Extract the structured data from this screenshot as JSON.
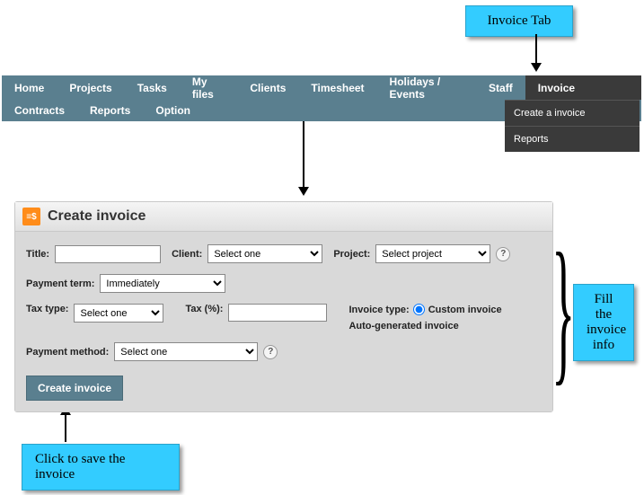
{
  "callouts": {
    "top": "Invoice Tab",
    "right": "Fill the invoice info",
    "bottom": "Click to save the invoice"
  },
  "nav": {
    "row1": [
      "Home",
      "Projects",
      "Tasks",
      "My files",
      "Clients",
      "Timesheet",
      "Holidays / Events",
      "Staff",
      "Invoice"
    ],
    "row2": [
      "Contracts",
      "Reports",
      "Option"
    ]
  },
  "dropdown": {
    "items": [
      "Create a invoice",
      "Reports"
    ]
  },
  "panel": {
    "title": "Create invoice"
  },
  "form": {
    "title_label": "Title:",
    "title_value": "",
    "client_label": "Client:",
    "client_selected": "Select one",
    "project_label": "Project:",
    "project_selected": "Select project",
    "payment_term_label": "Payment term:",
    "payment_term_selected": "Immediately",
    "tax_type_label": "Tax type:",
    "tax_type_selected": "Select one",
    "tax_pct_label": "Tax (%):",
    "tax_pct_value": "",
    "invoice_type_label": "Invoice type:",
    "invoice_type_options": {
      "custom": "Custom invoice",
      "auto": "Auto-generated invoice"
    },
    "payment_method_label": "Payment method:",
    "payment_method_selected": "Select one",
    "submit_label": "Create invoice",
    "help": "?"
  }
}
